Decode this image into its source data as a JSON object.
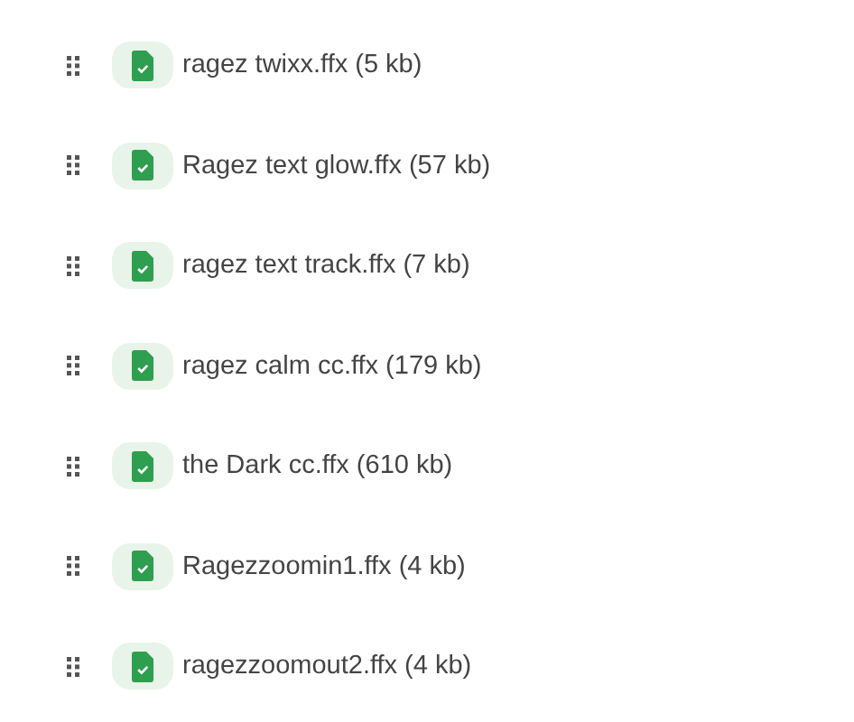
{
  "files": [
    {
      "name": "ragez twixx.ffx (5 kb)"
    },
    {
      "name": "Ragez text glow.ffx (57 kb)"
    },
    {
      "name": "ragez text track.ffx (7 kb)"
    },
    {
      "name": "ragez calm cc.ffx (179 kb)"
    },
    {
      "name": "the Dark cc.ffx (610 kb)"
    },
    {
      "name": "Ragezzoomin1.ffx (4 kb)"
    },
    {
      "name": "ragezzoomout2.ffx (4 kb)"
    }
  ]
}
